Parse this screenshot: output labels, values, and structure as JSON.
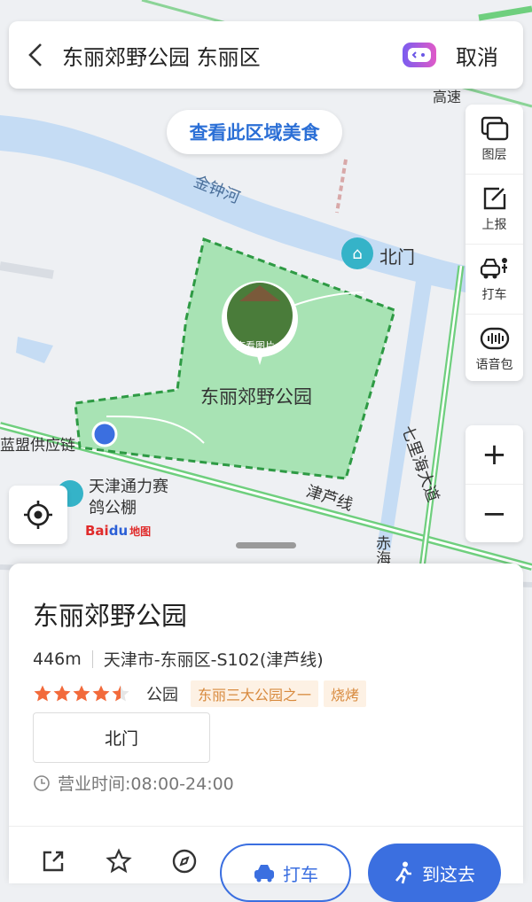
{
  "search": {
    "query": "东丽郊野公园 东丽区",
    "cancel_label": "取消"
  },
  "map": {
    "food_button": "查看此区域美食",
    "labels": {
      "river": "金钟河",
      "north_gate": "北门",
      "park_name": "东丽郊野公园",
      "view_photo": "查看图片",
      "road_jinlu": "津芦线",
      "road_qili": "七里海大道",
      "supply_chain": "蓝盟供应链",
      "pigeon_shed": "天津通力赛鸽公棚",
      "top_road": "高速",
      "chi": "赤海"
    },
    "logo": {
      "bai": "Bai",
      "du": "du",
      "ditu": "地图"
    }
  },
  "tools": [
    {
      "label": "图层",
      "icon": "layers-icon"
    },
    {
      "label": "上报",
      "icon": "report-icon"
    },
    {
      "label": "打车",
      "icon": "taxi-icon"
    },
    {
      "label": "语音包",
      "icon": "voice-pack-icon"
    }
  ],
  "zoom": {
    "in": "+",
    "out": "−"
  },
  "poi": {
    "title": "东丽郊野公园",
    "distance": "446m",
    "address": "天津市-东丽区-S102(津芦线)",
    "rating": 4.5,
    "category": "公园",
    "tags": [
      "东丽三大公园之一",
      "烧烤"
    ],
    "entrance": "北门",
    "hours": "营业时间:08:00-24:00"
  },
  "actions": {
    "taxi": "打车",
    "go_here": "到这去"
  },
  "colors": {
    "accent": "#3b6fe0",
    "park_fill": "#a8e3b4",
    "park_border": "#2e9a44",
    "water": "#bfdaf5"
  }
}
